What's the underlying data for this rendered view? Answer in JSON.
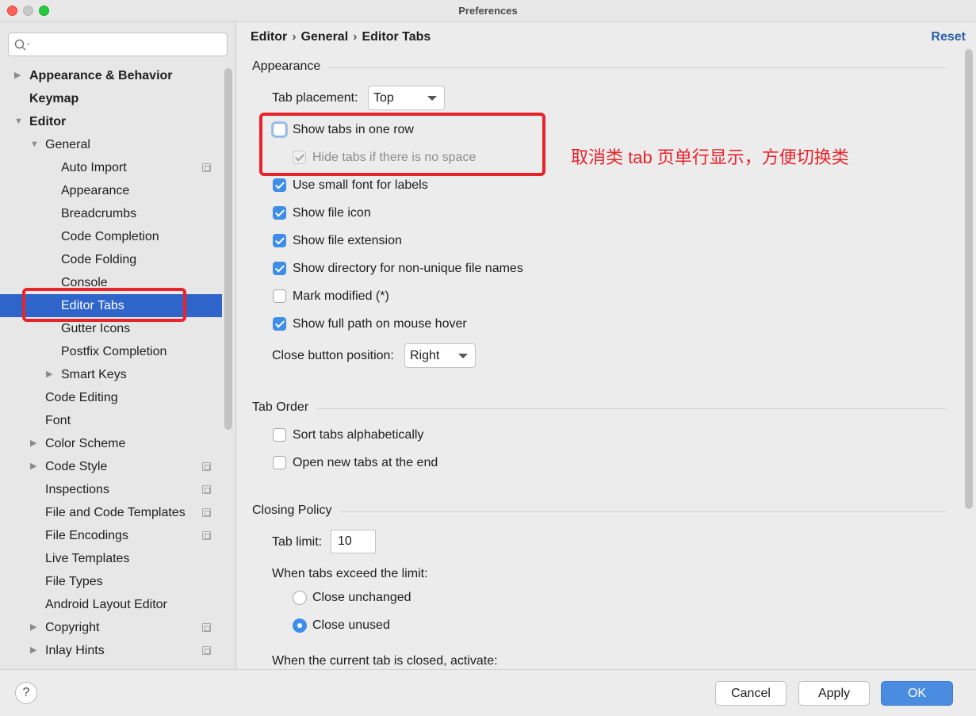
{
  "window": {
    "title": "Preferences"
  },
  "search": {
    "placeholder": "",
    "value": ""
  },
  "sidebar": {
    "items": [
      {
        "label": "Appearance & Behavior"
      },
      {
        "label": "Keymap"
      },
      {
        "label": "Editor"
      },
      {
        "label": "General"
      },
      {
        "label": "Auto Import"
      },
      {
        "label": "Appearance"
      },
      {
        "label": "Breadcrumbs"
      },
      {
        "label": "Code Completion"
      },
      {
        "label": "Code Folding"
      },
      {
        "label": "Console"
      },
      {
        "label": "Editor Tabs"
      },
      {
        "label": "Gutter Icons"
      },
      {
        "label": "Postfix Completion"
      },
      {
        "label": "Smart Keys"
      },
      {
        "label": "Code Editing"
      },
      {
        "label": "Font"
      },
      {
        "label": "Color Scheme"
      },
      {
        "label": "Code Style"
      },
      {
        "label": "Inspections"
      },
      {
        "label": "File and Code Templates"
      },
      {
        "label": "File Encodings"
      },
      {
        "label": "Live Templates"
      },
      {
        "label": "File Types"
      },
      {
        "label": "Android Layout Editor"
      },
      {
        "label": "Copyright"
      },
      {
        "label": "Inlay Hints"
      }
    ],
    "selected": "Editor Tabs"
  },
  "breadcrumb": {
    "items": [
      "Editor",
      "General",
      "Editor Tabs"
    ],
    "separator": "›"
  },
  "reset_label": "Reset",
  "appearance": {
    "title": "Appearance",
    "tab_placement_label": "Tab placement:",
    "tab_placement_value": "Top",
    "options": {
      "show_tabs_one_row": {
        "label": "Show tabs in one row",
        "checked": false
      },
      "hide_tabs_no_space": {
        "label": "Hide tabs if there is no space",
        "checked": true,
        "disabled": true
      },
      "small_font": {
        "label": "Use small font for labels",
        "checked": true
      },
      "file_icon": {
        "label": "Show file icon",
        "checked": true
      },
      "file_extension": {
        "label": "Show file extension",
        "checked": true
      },
      "directory_names": {
        "label": "Show directory for non-unique file names",
        "checked": true
      },
      "mark_modified": {
        "label": "Mark modified (*)",
        "checked": false
      },
      "full_path_hover": {
        "label": "Show full path on mouse hover",
        "checked": true
      }
    },
    "close_button_label": "Close button position:",
    "close_button_value": "Right"
  },
  "tab_order": {
    "title": "Tab Order",
    "sort_alpha": {
      "label": "Sort tabs alphabetically",
      "checked": false
    },
    "open_at_end": {
      "label": "Open new tabs at the end",
      "checked": false
    }
  },
  "closing_policy": {
    "title": "Closing Policy",
    "tab_limit_label": "Tab limit:",
    "tab_limit_value": "10",
    "exceed_label": "When tabs exceed the limit:",
    "close_unchanged": {
      "label": "Close unchanged",
      "selected": false
    },
    "close_unused": {
      "label": "Close unused",
      "selected": true
    },
    "activate_label": "When the current tab is closed, activate:"
  },
  "annotation": {
    "text": "取消类 tab 页单行显示，方便切换类",
    "color": "#e8232a"
  },
  "footer": {
    "help_label": "?",
    "cancel_label": "Cancel",
    "apply_label": "Apply",
    "ok_label": "OK"
  },
  "colors": {
    "accent": "#3e8ee9",
    "selection": "#2f65ca",
    "annotation": "#e8232a"
  }
}
